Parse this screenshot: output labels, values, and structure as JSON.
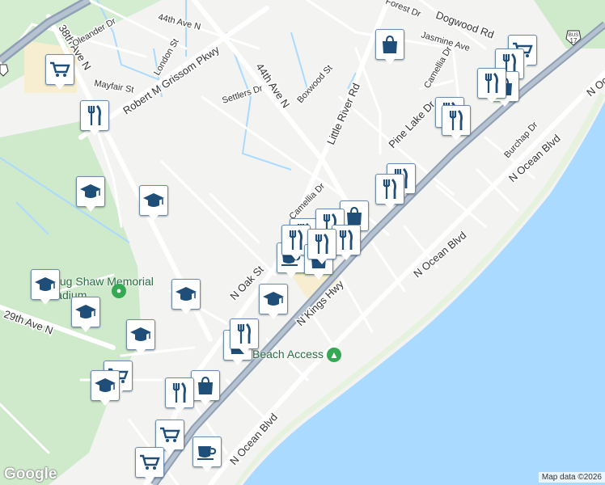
{
  "map": {
    "colors": {
      "water": "#aadaff",
      "land": "#f3f4f1",
      "park": "#cdeccc",
      "road": "#ffffff",
      "highway": "#8fa0b6",
      "pin_icon": "#1f4e78",
      "poi_green": "#34a853"
    },
    "road_labels": [
      {
        "name": "44th Ave N"
      },
      {
        "name": "38th Ave N"
      },
      {
        "name": "Oleander Dr"
      },
      {
        "name": "London St"
      },
      {
        "name": "Mayfair St"
      },
      {
        "name": "Robert M Grissom Pkwy"
      },
      {
        "name": "Settlers Dr"
      },
      {
        "name": "44th Ave N"
      },
      {
        "name": "Boxwood St"
      },
      {
        "name": "Little River Rd"
      },
      {
        "name": "Forest Dr"
      },
      {
        "name": "Dogwood Rd"
      },
      {
        "name": "Jasmine Ave"
      },
      {
        "name": "Camellia Dr"
      },
      {
        "name": "Pine Lake Dr"
      },
      {
        "name": "Camellia Dr"
      },
      {
        "name": "Burchap Dr"
      },
      {
        "name": "N Ocean Blvd"
      },
      {
        "name": "N Ocean Blvd"
      },
      {
        "name": "N Ocean Blvd"
      },
      {
        "name": "N Kings Hwy"
      },
      {
        "name": "N Oak St"
      },
      {
        "name": "29th Ave N"
      },
      {
        "name": "Doug Shaw Memorial Stadium"
      },
      {
        "name": "Beach Access"
      },
      {
        "name": "N Ocean Blvd"
      }
    ],
    "highway_shield": "17",
    "highway_shield_top": "BUS",
    "markers": [
      {
        "type": "grocery"
      },
      {
        "type": "restaurant"
      },
      {
        "type": "school"
      },
      {
        "type": "school"
      },
      {
        "type": "school"
      },
      {
        "type": "school"
      },
      {
        "type": "school"
      },
      {
        "type": "school"
      },
      {
        "type": "school"
      },
      {
        "type": "grocery"
      },
      {
        "type": "school"
      },
      {
        "type": "shopping"
      },
      {
        "type": "grocery"
      },
      {
        "type": "restaurant"
      },
      {
        "type": "shopping"
      },
      {
        "type": "restaurant"
      },
      {
        "type": "restaurant"
      },
      {
        "type": "restaurant"
      },
      {
        "type": "restaurant"
      },
      {
        "type": "shopping"
      },
      {
        "type": "restaurant"
      },
      {
        "type": "restaurant"
      },
      {
        "type": "cafe"
      },
      {
        "type": "restaurant"
      },
      {
        "type": "restaurant"
      },
      {
        "type": "shopping"
      },
      {
        "type": "restaurant"
      },
      {
        "type": "shopping"
      },
      {
        "type": "restaurant"
      },
      {
        "type": "shopping"
      },
      {
        "type": "restaurant"
      },
      {
        "type": "grocery"
      },
      {
        "type": "grocery"
      },
      {
        "type": "cafe"
      }
    ],
    "logo": "Google",
    "attribution": "Map data ©2026"
  }
}
